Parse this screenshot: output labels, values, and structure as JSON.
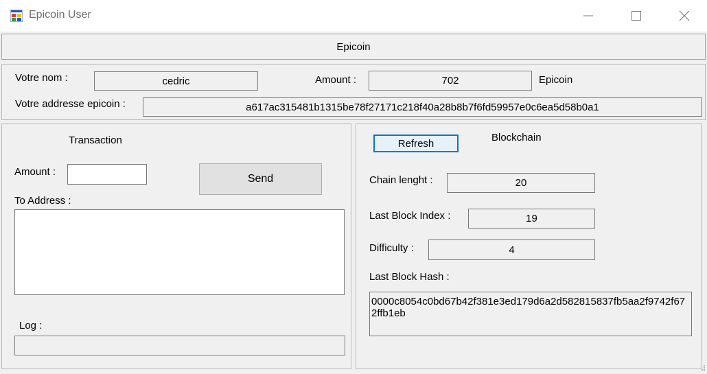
{
  "window": {
    "title": "Epicoin User",
    "minimize_icon": "minimize-icon",
    "maximize_icon": "maximize-icon",
    "close_icon": "close-icon"
  },
  "header": {
    "label": "Epicoin"
  },
  "user": {
    "name_label": "Votre nom :",
    "name_value": "cedric",
    "amount_label": "Amount :",
    "amount_value": "702",
    "currency": "Epicoin",
    "address_label": "Votre addresse epicoin :",
    "address_value": "a617ac315481b1315be78f27171c218f40a28b8b7f6fd59957e0c6ea5d58b0a1"
  },
  "transaction": {
    "title": "Transaction",
    "amount_label": "Amount :",
    "amount_value": "",
    "send_label": "Send",
    "to_address_label": "To Address :",
    "to_address_value": "",
    "log_label": "Log :",
    "log_value": ""
  },
  "blockchain": {
    "title": "Blockchain",
    "refresh_label": "Refresh",
    "chain_length_label": "Chain lenght :",
    "chain_length_value": "20",
    "last_index_label": "Last Block Index :",
    "last_index_value": "19",
    "difficulty_label": "Difficulty :",
    "difficulty_value": "4",
    "last_hash_label": "Last Block Hash :",
    "last_hash_value": "0000c8054c0bd67b42f381e3ed179d6a2d582815837fb5aa2f9742f672ffb1eb"
  }
}
